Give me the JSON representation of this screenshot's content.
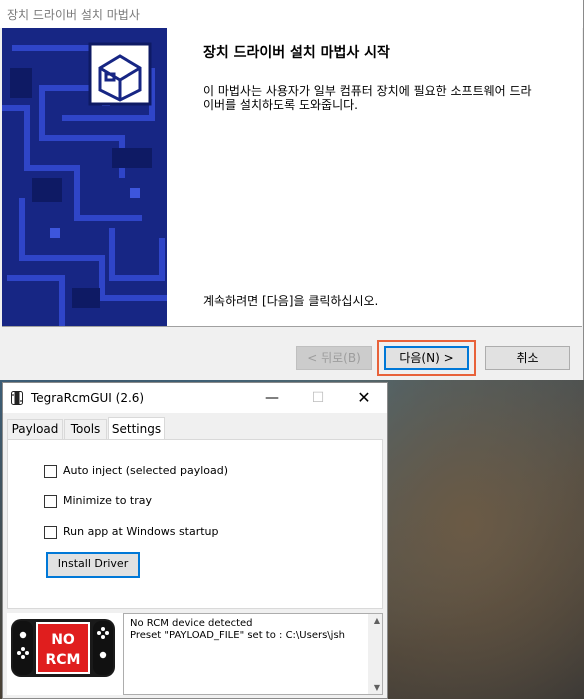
{
  "wizard": {
    "title": "장치 드라이버 설치 마법사",
    "heading": "장치 드라이버 설치 마법사 시작",
    "description": "이 마법사는 사용자가 일부 컴퓨터 장치에 필요한 소프트웨어 드라이버를 설치하도록 도와줍니다.",
    "continue_text": "계속하려면 [다음]을 클릭하십시오.",
    "back_label": "< 뒤로(B)",
    "next_label": "다음(N) >",
    "cancel_label": "취소",
    "banner_color": "#172684",
    "highlight_color": "#e8623a"
  },
  "tegra": {
    "title": "TegraRcmGUI (2.6)",
    "tabs": [
      {
        "label": "Payload"
      },
      {
        "label": "Tools"
      },
      {
        "label": "Settings"
      }
    ],
    "active_tab": "Settings",
    "settings": {
      "auto_inject_label": "Auto inject (selected payload)",
      "minimize_to_tray_label": "Minimize to tray",
      "run_at_startup_label": "Run app at Windows startup",
      "install_driver_label": "Install Driver"
    },
    "status": {
      "line1": "NO",
      "line2": "RCM",
      "badge_color": "#e01e1e"
    },
    "console": [
      "No RCM device detected",
      "Preset \"PAYLOAD_FILE\" set to : C:\\Users\\jsh"
    ]
  }
}
